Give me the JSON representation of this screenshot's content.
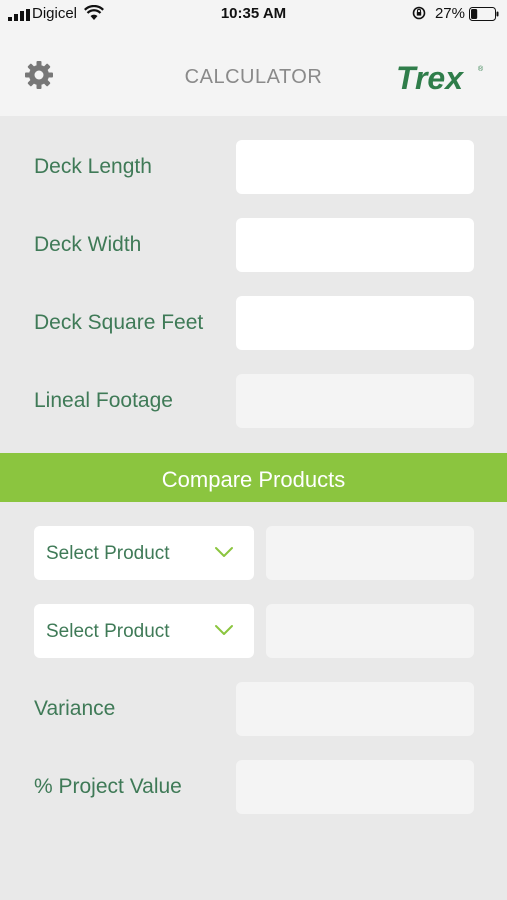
{
  "status_bar": {
    "carrier": "Digicel",
    "time": "10:35 AM",
    "battery_percent": "27%",
    "battery_level": 0.27,
    "icons": [
      "signal-icon",
      "wifi-icon",
      "rotation-lock-icon",
      "battery-icon"
    ]
  },
  "nav": {
    "title": "CALCULATOR",
    "logo_text": "Trex",
    "settings_icon": "gear-icon"
  },
  "inputs": [
    {
      "label": "Deck Length",
      "value": "",
      "readonly": false
    },
    {
      "label": "Deck Width",
      "value": "",
      "readonly": false
    },
    {
      "label": "Deck Square Feet",
      "value": "",
      "readonly": false
    },
    {
      "label": "Lineal Footage",
      "value": "",
      "readonly": true
    }
  ],
  "compare": {
    "title": "Compare Products",
    "selects": [
      {
        "label": "Select Product",
        "icon": "chevron-down-icon",
        "result": ""
      },
      {
        "label": "Select Product",
        "icon": "chevron-down-icon",
        "result": ""
      }
    ]
  },
  "results": [
    {
      "label": "Variance",
      "value": ""
    },
    {
      "label": "% Project Value",
      "value": ""
    }
  ],
  "colors": {
    "brand_green": "#8bc53f",
    "label_green": "#3f7a57",
    "logo_green": "#2f7d4a",
    "background": "#e9e9e9",
    "bar_background": "#f4f4f4"
  }
}
